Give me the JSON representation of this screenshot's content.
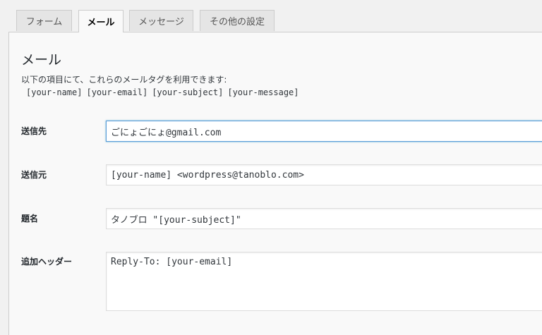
{
  "tabs": [
    {
      "label": "フォーム",
      "active": false
    },
    {
      "label": "メール",
      "active": true
    },
    {
      "label": "メッセージ",
      "active": false
    },
    {
      "label": "その他の設定",
      "active": false
    }
  ],
  "panel": {
    "title": "メール",
    "description": "以下の項目にて、これらのメールタグを利用できます:",
    "mail_tags": [
      "[your-name]",
      "[your-email]",
      "[your-subject]",
      "[your-message]"
    ]
  },
  "fields": {
    "to": {
      "label": "送信先",
      "value": "ごにょごにょ@gmail.com"
    },
    "from": {
      "label": "送信元",
      "value": "[your-name] <wordpress@tanoblo.com>"
    },
    "subject": {
      "label": "題名",
      "value": "タノブロ \"[your-subject]\""
    },
    "headers": {
      "label": "追加ヘッダー",
      "value": "Reply-To: [your-email]"
    }
  },
  "colors": {
    "background": "#f1f1f1",
    "panel": "#f9f9f9",
    "focus_border": "#5b9dd9"
  }
}
